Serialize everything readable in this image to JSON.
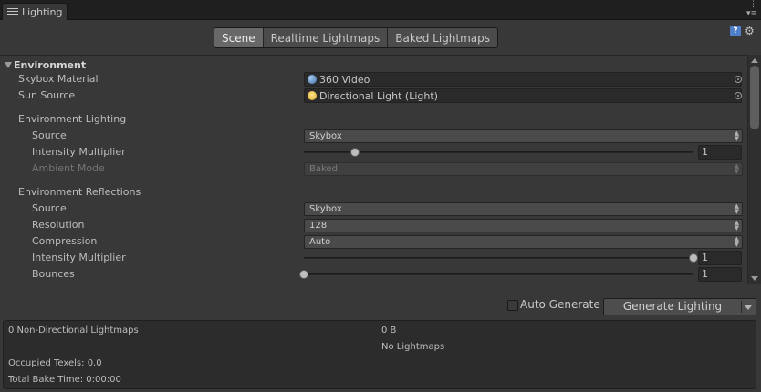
{
  "window": {
    "tab_title": "Lighting",
    "tab_icon": "list-icon",
    "menu_icon": "kebab-menu-icon",
    "help_icon": "help-icon",
    "settings_icon": "gear-icon"
  },
  "mode_tabs": [
    "Scene",
    "Realtime Lightmaps",
    "Baked Lightmaps"
  ],
  "active_mode": "Scene",
  "environment": {
    "header": "Environment",
    "skybox_material": {
      "label": "Skybox Material",
      "value": "360 Video",
      "icon": "sphere-icon"
    },
    "sun_source": {
      "label": "Sun Source",
      "value": "Directional Light (Light)",
      "icon": "lightbulb-icon"
    },
    "lighting": {
      "header": "Environment Lighting",
      "source": {
        "label": "Source",
        "value": "Skybox"
      },
      "intensity": {
        "label": "Intensity Multiplier",
        "value": "1",
        "level": 0.13
      },
      "ambient_mode": {
        "label": "Ambient Mode",
        "value": "Baked",
        "disabled": true
      }
    },
    "reflections": {
      "header": "Environment Reflections",
      "source": {
        "label": "Source",
        "value": "Skybox"
      },
      "resolution": {
        "label": "Resolution",
        "value": "128"
      },
      "compression": {
        "label": "Compression",
        "value": "Auto"
      },
      "intensity": {
        "label": "Intensity Multiplier",
        "value": "1",
        "level": 1.0
      },
      "bounces": {
        "label": "Bounces",
        "value": "1",
        "level": 0.0
      }
    }
  },
  "auto_generate": {
    "label": "Auto Generate",
    "checked": false
  },
  "generate_button": "Generate Lighting",
  "stats": {
    "lightmaps": "0 Non-Directional Lightmaps",
    "size": "0 B",
    "no_lightmaps": "No Lightmaps",
    "occupied_texels": "Occupied Texels: 0.0",
    "bake_time": "Total Bake Time: 0:00:00"
  },
  "colors": {
    "background": "#383838",
    "tab_bar": "#1f1f1f",
    "field": "#2a2a2a",
    "text": "#bdbdbd"
  }
}
